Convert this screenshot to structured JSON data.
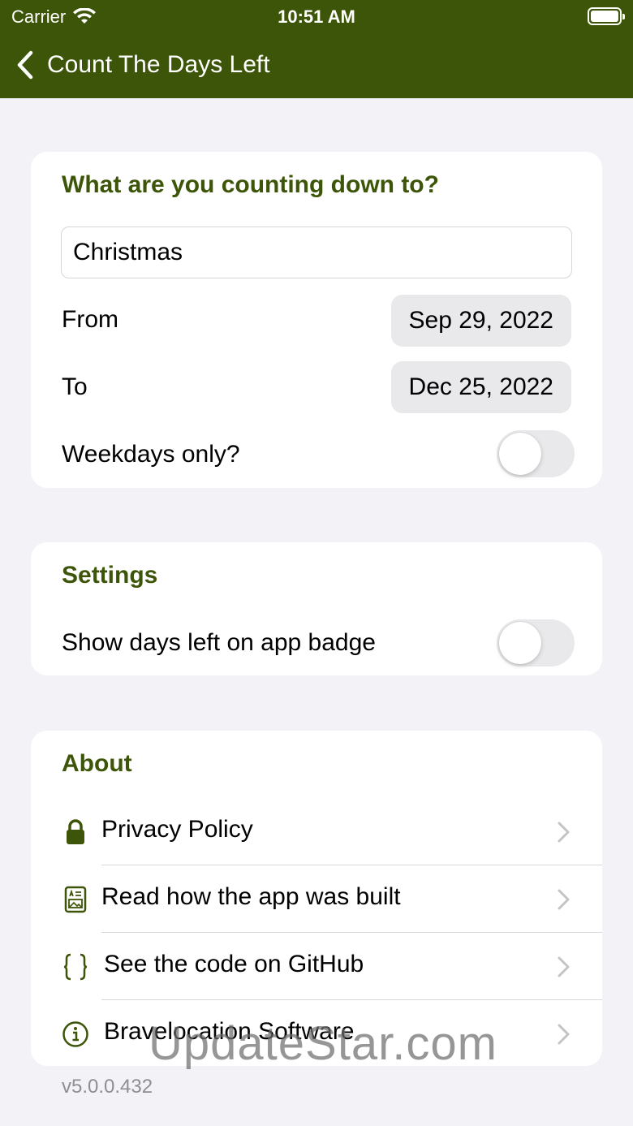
{
  "status_bar": {
    "carrier": "Carrier",
    "time": "10:51 AM"
  },
  "nav": {
    "title": "Count The Days Left"
  },
  "countdown": {
    "header": "What are you counting down to?",
    "event_name": "Christmas",
    "from_label": "From",
    "from_date": "Sep 29, 2022",
    "to_label": "To",
    "to_date": "Dec 25, 2022",
    "weekdays_label": "Weekdays only?",
    "weekdays_on": false
  },
  "settings": {
    "header": "Settings",
    "badge_label": "Show days left on app badge",
    "badge_on": false
  },
  "about": {
    "header": "About",
    "items": [
      {
        "label": "Privacy Policy",
        "icon": "lock-icon"
      },
      {
        "label": "Read how the app was built",
        "icon": "document-icon"
      },
      {
        "label": "See the code on GitHub",
        "icon": "code-braces-icon"
      },
      {
        "label": "Bravelocation Software",
        "icon": "info-icon"
      }
    ]
  },
  "version": "v5.0.0.432",
  "watermark": "UpdateStar.com",
  "colors": {
    "brand": "#3d5508",
    "background": "#f2f2f7"
  }
}
